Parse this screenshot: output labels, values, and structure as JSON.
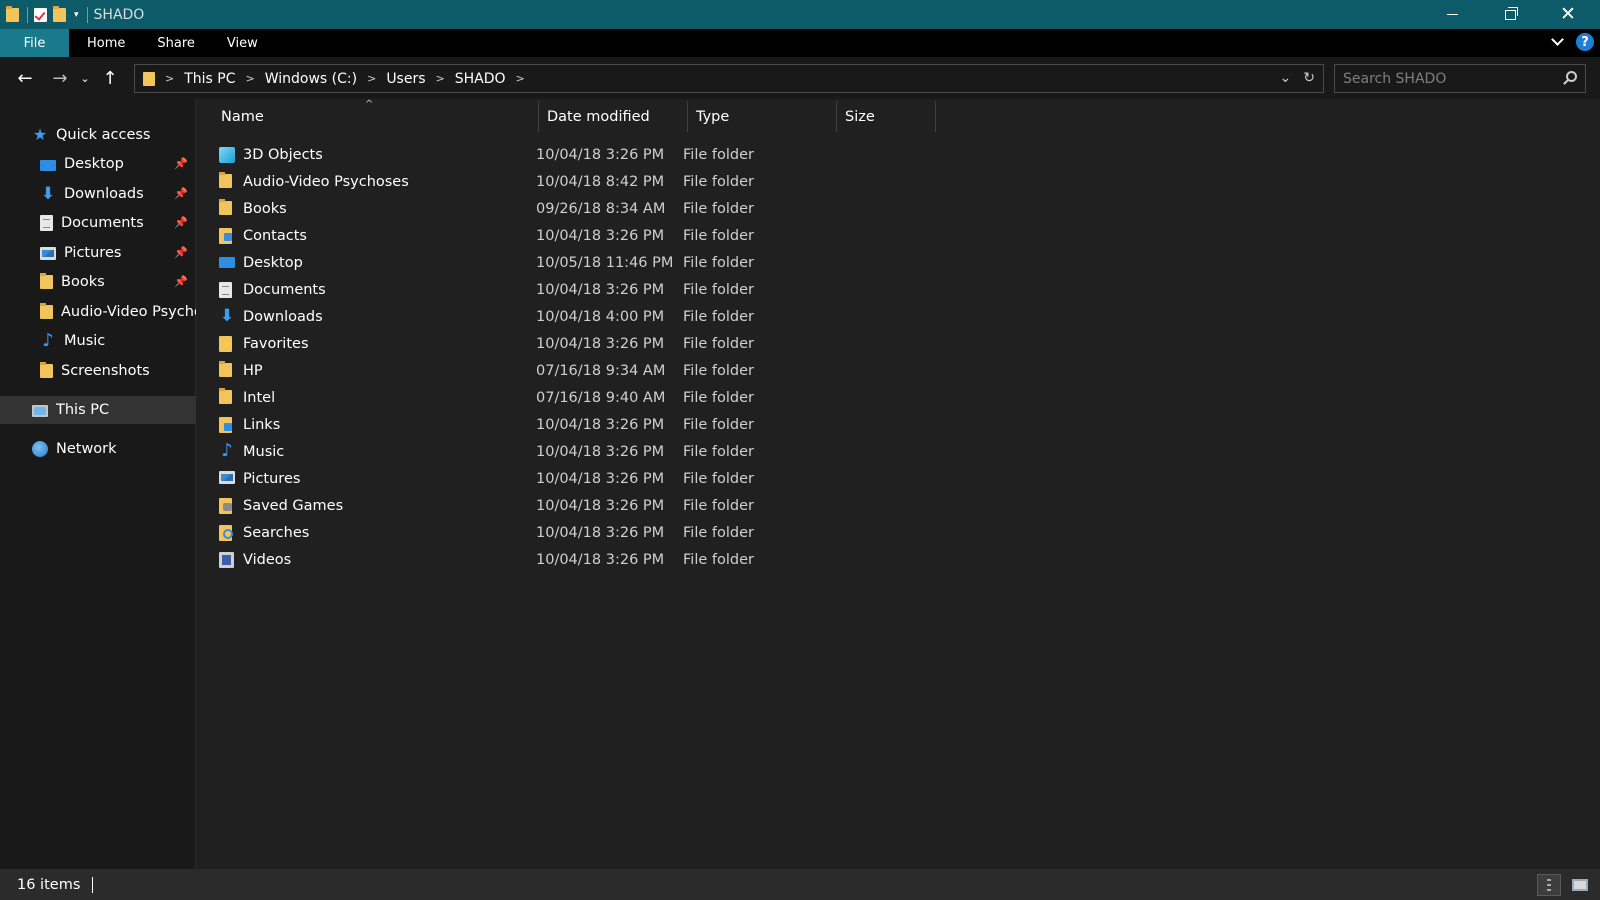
{
  "window": {
    "title": "SHADO"
  },
  "ribbon": {
    "tabs": [
      "File",
      "Home",
      "Share",
      "View"
    ],
    "help": "?"
  },
  "navigation": {
    "back": "←",
    "forward": "→",
    "recent": "⌄",
    "up": "↑",
    "breadcrumb": [
      "This PC",
      "Windows (C:)",
      "Users",
      "SHADO"
    ],
    "search_placeholder": "Search SHADO"
  },
  "sidebar": {
    "items": [
      {
        "label": "Quick access",
        "icon": "star-icon",
        "pinned": false
      },
      {
        "label": "Desktop",
        "icon": "desktop-icon",
        "pinned": true
      },
      {
        "label": "Downloads",
        "icon": "download-icon",
        "pinned": true
      },
      {
        "label": "Documents",
        "icon": "documents-icon",
        "pinned": true
      },
      {
        "label": "Pictures",
        "icon": "pictures-icon",
        "pinned": true
      },
      {
        "label": "Books",
        "icon": "folder-icon",
        "pinned": true
      },
      {
        "label": "Audio-Video Psychoses",
        "icon": "folder-icon",
        "pinned": false
      },
      {
        "label": "Music",
        "icon": "music-icon",
        "pinned": false
      },
      {
        "label": "Screenshots",
        "icon": "folder-icon",
        "pinned": false
      },
      {
        "label": "This PC",
        "icon": "computer-icon",
        "pinned": false,
        "selected": true
      },
      {
        "label": "Network",
        "icon": "network-icon",
        "pinned": false
      }
    ]
  },
  "columns": {
    "name": "Name",
    "date": "Date modified",
    "type": "Type",
    "size": "Size"
  },
  "files": [
    {
      "name": "3D Objects",
      "date": "10/04/18 3:26 PM",
      "type": "File folder",
      "icon": "3d-objects-icon"
    },
    {
      "name": "Audio-Video Psychoses",
      "date": "10/04/18 8:42 PM",
      "type": "File folder",
      "icon": "folder-icon"
    },
    {
      "name": "Books",
      "date": "09/26/18 8:34 AM",
      "type": "File folder",
      "icon": "folder-icon"
    },
    {
      "name": "Contacts",
      "date": "10/04/18 3:26 PM",
      "type": "File folder",
      "icon": "contacts-icon"
    },
    {
      "name": "Desktop",
      "date": "10/05/18 11:46 PM",
      "type": "File folder",
      "icon": "desktop-icon"
    },
    {
      "name": "Documents",
      "date": "10/04/18 3:26 PM",
      "type": "File folder",
      "icon": "documents-icon"
    },
    {
      "name": "Downloads",
      "date": "10/04/18 4:00 PM",
      "type": "File folder",
      "icon": "download-icon"
    },
    {
      "name": "Favorites",
      "date": "10/04/18 3:26 PM",
      "type": "File folder",
      "icon": "favorites-icon"
    },
    {
      "name": "HP",
      "date": "07/16/18 9:34 AM",
      "type": "File folder",
      "icon": "folder-icon"
    },
    {
      "name": "Intel",
      "date": "07/16/18 9:40 AM",
      "type": "File folder",
      "icon": "folder-icon"
    },
    {
      "name": "Links",
      "date": "10/04/18 3:26 PM",
      "type": "File folder",
      "icon": "links-icon"
    },
    {
      "name": "Music",
      "date": "10/04/18 3:26 PM",
      "type": "File folder",
      "icon": "music-icon"
    },
    {
      "name": "Pictures",
      "date": "10/04/18 3:26 PM",
      "type": "File folder",
      "icon": "pictures-icon"
    },
    {
      "name": "Saved Games",
      "date": "10/04/18 3:26 PM",
      "type": "File folder",
      "icon": "saved-games-icon"
    },
    {
      "name": "Searches",
      "date": "10/04/18 3:26 PM",
      "type": "File folder",
      "icon": "searches-icon"
    },
    {
      "name": "Videos",
      "date": "10/04/18 3:26 PM",
      "type": "File folder",
      "icon": "videos-icon"
    }
  ],
  "status": {
    "item_count": "16 items"
  },
  "colors": {
    "titlebar": "#0d5b68",
    "file_tab": "#197a8c",
    "accent": "#2d8fe3",
    "folder": "#f2c55c"
  }
}
